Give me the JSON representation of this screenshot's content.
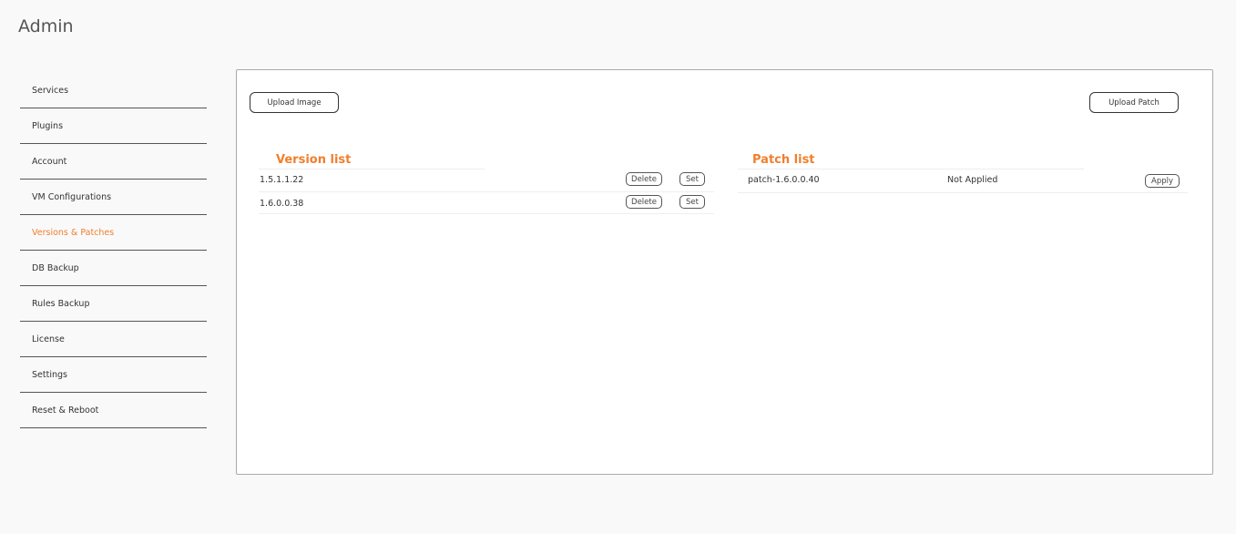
{
  "page": {
    "title": "Admin"
  },
  "sidebar": {
    "items": [
      {
        "label": "Services"
      },
      {
        "label": "Plugins"
      },
      {
        "label": "Account"
      },
      {
        "label": "VM Configurations"
      },
      {
        "label": "Versions & Patches",
        "active": true
      },
      {
        "label": "DB Backup"
      },
      {
        "label": "Rules Backup"
      },
      {
        "label": "License"
      },
      {
        "label": "Settings"
      },
      {
        "label": "Reset & Reboot"
      }
    ]
  },
  "toolbar": {
    "upload_image_label": "Upload Image",
    "upload_patch_label": "Upload Patch"
  },
  "versions": {
    "title": "Version list",
    "delete_label": "Delete",
    "set_label": "Set",
    "rows": [
      {
        "version": "1.5.1.1.22"
      },
      {
        "version": "1.6.0.0.38"
      }
    ]
  },
  "patches": {
    "title": "Patch list",
    "apply_label": "Apply",
    "rows": [
      {
        "name": "patch-1.6.0.0.40",
        "status": "Not Applied"
      }
    ]
  },
  "colors": {
    "accent": "#f07f2e",
    "background": "#f9f9f9",
    "panel": "#ffffff"
  }
}
